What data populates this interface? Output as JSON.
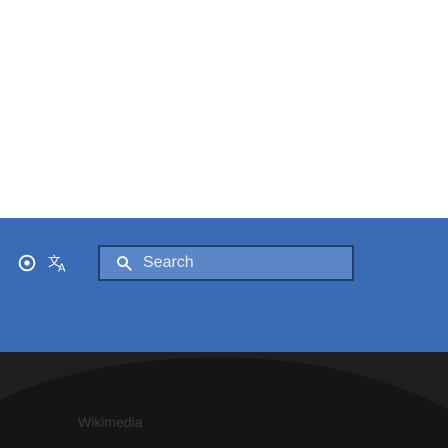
{
  "search": {
    "label": "Search"
  },
  "footer": {
    "text": "Wikimedia"
  },
  "icons": {
    "settings": "settings-icon",
    "translate": "translate-icon",
    "search": "search-icon"
  },
  "colors": {
    "toolbar_bg": "#3a6bb5",
    "search_bg": "#5b86c8",
    "search_border": "#1f3f73",
    "footer_bg": "#1f1f1f"
  }
}
